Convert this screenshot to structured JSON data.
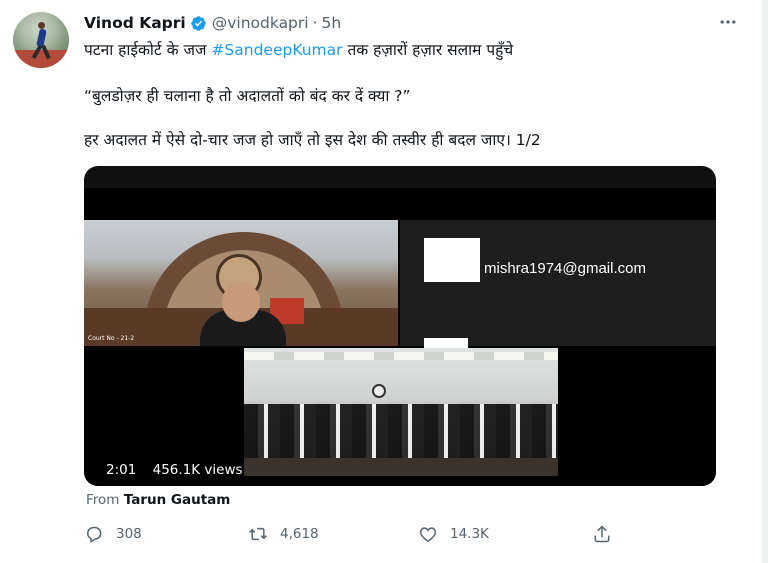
{
  "author": {
    "name": "Vinod Kapri",
    "handle": "@vinodkapri",
    "separator": "·",
    "time": "5h"
  },
  "tweet": {
    "line1_pre": "पटना हाईकोर्ट के जज ",
    "hashtag": "#SandeepKumar",
    "line1_post": " तक हज़ारों हज़ार सलाम पहुँचे",
    "line2": "“बुलडोज़र ही चलाना है तो अदालतों को बंद कर दें क्या ?”",
    "line3": "हर अदालत में ऐसे दो-चार जज हो जाएँ तो इस देश की तस्वीर ही बदल जाए। 1/2"
  },
  "media": {
    "email": "mishra1974@gmail.com",
    "court_tag": "Court No - 21-2",
    "duration": "2:01",
    "views": "456.1K views"
  },
  "attribution": {
    "from_label": "From",
    "from_name": "Tarun Gautam"
  },
  "actions": {
    "replies": "308",
    "retweets": "4,618",
    "likes": "14.3K"
  },
  "colors": {
    "accent": "#1d9bf0",
    "secondary_text": "#536471",
    "primary_text": "#0f1419"
  },
  "icons": [
    "verified-badge-icon",
    "more-icon",
    "reply-icon",
    "retweet-icon",
    "like-icon",
    "share-icon"
  ]
}
